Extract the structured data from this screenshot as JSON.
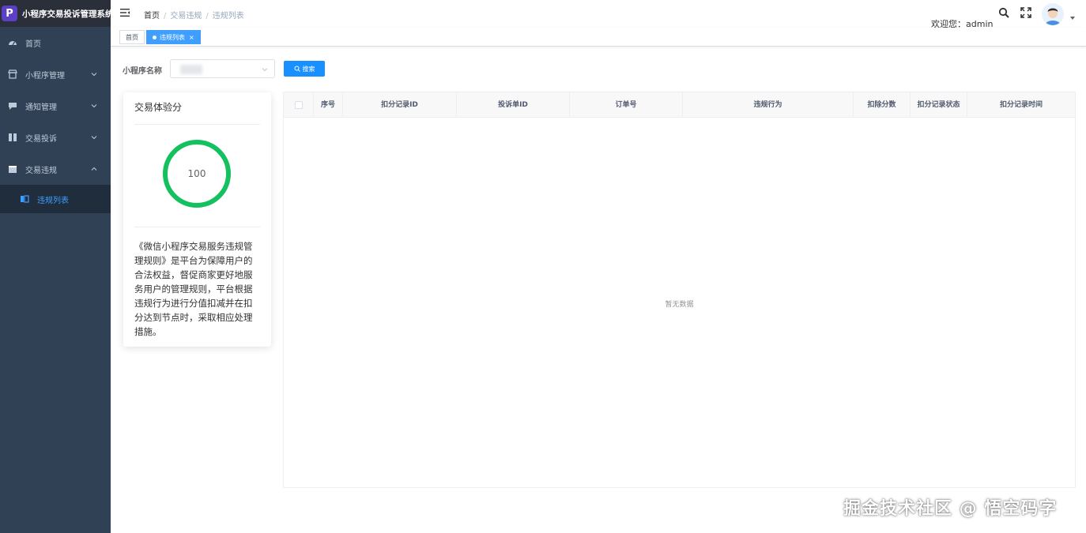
{
  "app": {
    "title": "小程序交易投诉管理系统",
    "logo_letter": "P"
  },
  "sidebar": {
    "items": [
      {
        "label": "首页",
        "icon": "dashboard-icon"
      },
      {
        "label": "小程序管理",
        "icon": "shop-icon",
        "expandable": true
      },
      {
        "label": "通知管理",
        "icon": "message-icon",
        "expandable": true
      },
      {
        "label": "交易投诉",
        "icon": "complaint-icon",
        "expandable": true
      },
      {
        "label": "交易违规",
        "icon": "violation-icon",
        "expandable": true,
        "expanded": true
      }
    ],
    "subitems": [
      {
        "label": "违规列表",
        "icon": "list-icon",
        "active": true
      }
    ]
  },
  "header": {
    "breadcrumb": [
      "首页",
      "交易违规",
      "违规列表"
    ],
    "welcome": "欢迎您：admin"
  },
  "tags": {
    "items": [
      {
        "label": "首页",
        "active": false
      },
      {
        "label": "违规列表",
        "active": true,
        "close": "×"
      }
    ]
  },
  "search": {
    "label": "小程序名称",
    "button_label": "搜索"
  },
  "score_card": {
    "title": "交易体验分",
    "score": "100",
    "score_fraction": 1.0,
    "description": "《微信小程序交易服务违规管理规则》是平台为保障用户的合法权益，督促商家更好地服务用户的管理规则，平台根据违规行为进行分值扣减并在扣分达到节点时，采取相应处理措施。"
  },
  "table": {
    "columns": [
      "序号",
      "扣分记录ID",
      "投诉单ID",
      "订单号",
      "违规行为",
      "扣除分数",
      "扣分记录状态",
      "扣分记录时间"
    ],
    "rows": [],
    "empty_text": "暂无数据"
  },
  "watermark": "掘金技术社区 @ 悟空码字",
  "colors": {
    "sidebar_bg": "#304156",
    "accent": "#409eff",
    "ring": "#13c15f",
    "button": "#1890ff"
  }
}
